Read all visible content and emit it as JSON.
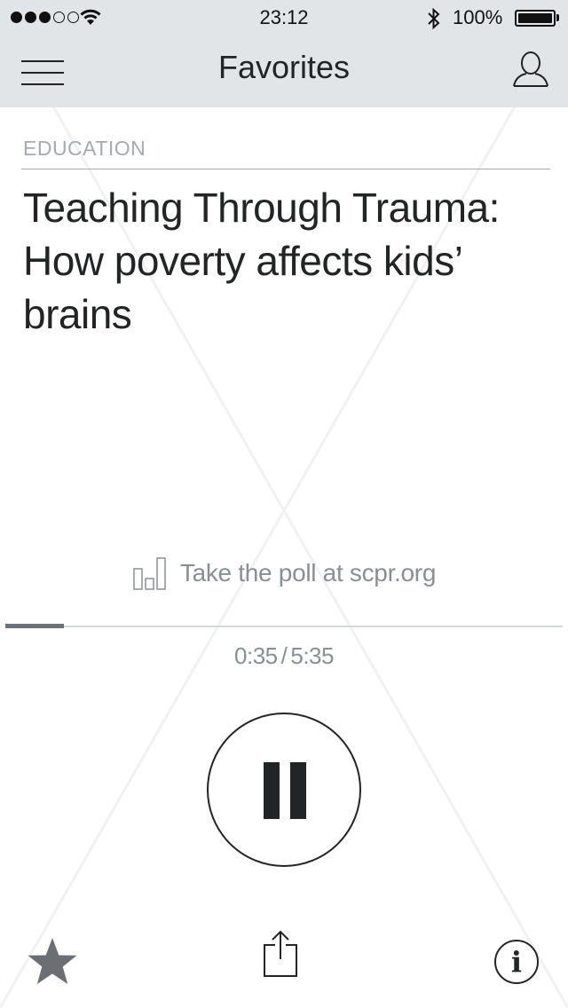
{
  "status_bar": {
    "signal_bars_filled": 3,
    "signal_bars_total": 5,
    "time": "23:12",
    "battery_percent": "100%",
    "battery_level": 1.0
  },
  "nav": {
    "title": "Favorites",
    "menu_icon": "hamburger-menu-icon",
    "profile_icon": "user-profile-icon"
  },
  "article": {
    "category": "EDUCATION",
    "headline_lines": [
      "Teaching Through Trauma:",
      "How poverty affects kids’",
      "brains"
    ]
  },
  "poll": {
    "icon": "bar-chart-icon",
    "label": "Take the poll at scpr.org"
  },
  "player": {
    "elapsed": "0:35",
    "separator": "/",
    "duration": "5:35",
    "progress_fraction": 0.1045,
    "state_icon": "pause-icon"
  },
  "toolbar": {
    "favorite_icon": "star-icon",
    "share_icon": "share-icon",
    "info_label": "i"
  },
  "colors": {
    "bar_background": "#e1e5e8",
    "text_dark": "#222426",
    "text_muted": "#8a8f94",
    "star": "#6b6f73"
  }
}
